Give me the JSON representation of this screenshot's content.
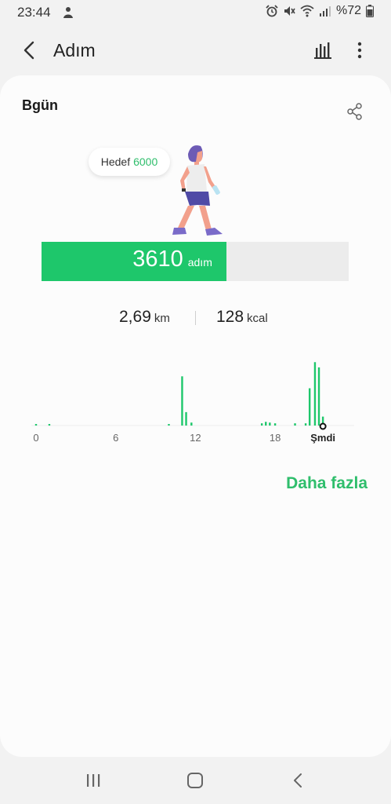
{
  "status_bar": {
    "time": "23:44",
    "battery": "%72",
    "icons": [
      "person-icon",
      "alarm-icon",
      "mute-icon",
      "wifi-icon",
      "signal-icon",
      "battery-icon"
    ]
  },
  "app_bar": {
    "title": "Adım",
    "icons": [
      "back-arrow-icon",
      "bar-chart-icon",
      "more-vert-icon"
    ]
  },
  "card": {
    "day_label": "Bgün",
    "goal": {
      "label": "Hedef",
      "value": "6000"
    },
    "steps": {
      "count": "3610",
      "unit": "adım",
      "progress": 0.6017
    },
    "stats": {
      "distance": {
        "value": "2,69",
        "unit": "km"
      },
      "calories": {
        "value": "128",
        "unit": "kcal"
      }
    },
    "more_link": "Daha fazla"
  },
  "colors": {
    "accent": "#1ec76b",
    "accent_text": "#2fbe6c",
    "track": "#ececec"
  },
  "chart_data": {
    "type": "bar",
    "x_ticks": [
      "0",
      "6",
      "12",
      "18",
      "Şmdi"
    ],
    "x": [
      0,
      1,
      10,
      11,
      11.3,
      11.7,
      17,
      17.3,
      17.6,
      18,
      19.5,
      20.3,
      20.6,
      21,
      21.3,
      21.6
    ],
    "values": [
      2,
      2,
      2,
      66,
      18,
      4,
      3,
      5,
      4,
      3,
      3,
      3,
      50,
      85,
      78,
      12
    ]
  },
  "nav_bar": {
    "icons": [
      "recent-apps-icon",
      "home-icon",
      "nav-back-icon"
    ]
  }
}
